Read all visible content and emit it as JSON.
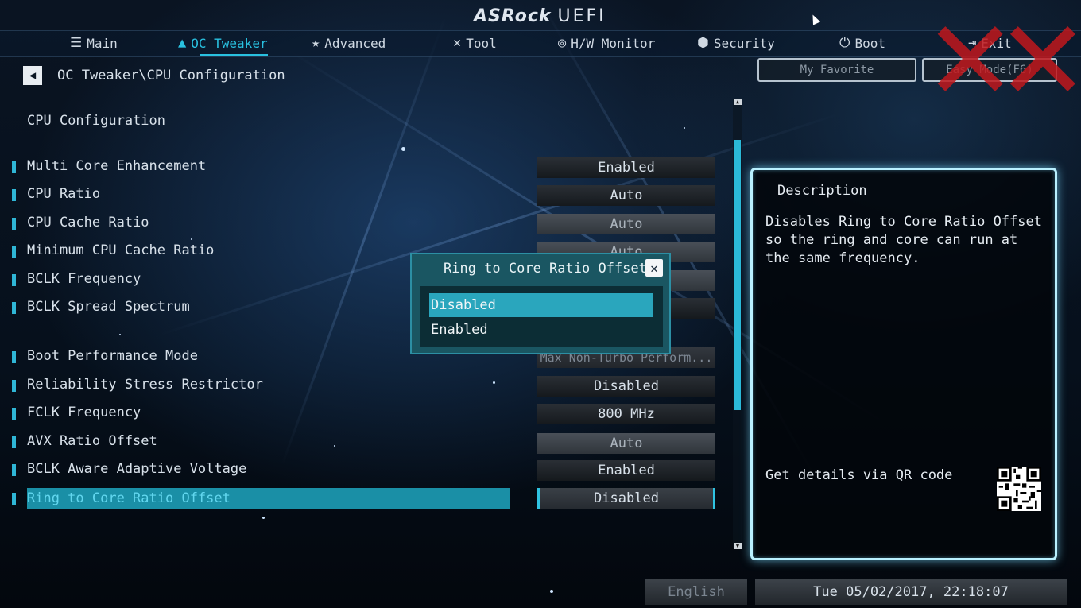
{
  "header": {
    "brand": "ASRock",
    "product": "UEFI",
    "watermark": "XX"
  },
  "tabs": [
    {
      "label": "Main",
      "icon": "list-icon"
    },
    {
      "label": "OC Tweaker",
      "icon": "flame-icon",
      "active": true
    },
    {
      "label": "Advanced",
      "icon": "star-icon"
    },
    {
      "label": "Tool",
      "icon": "tools-icon"
    },
    {
      "label": "H/W Monitor",
      "icon": "monitor-icon"
    },
    {
      "label": "Security",
      "icon": "shield-icon"
    },
    {
      "label": "Boot",
      "icon": "power-icon"
    },
    {
      "label": "Exit",
      "icon": "exit-icon"
    }
  ],
  "breadcrumb": "OC Tweaker\\CPU Configuration",
  "buttons": {
    "favorite": "My Favorite",
    "easy_mode": "Easy Mode(F6)"
  },
  "section_title": "CPU Configuration",
  "settings": [
    {
      "label": "Multi Core Enhancement",
      "value": "Enabled"
    },
    {
      "label": "CPU Ratio",
      "value": "Auto"
    },
    {
      "label": "CPU Cache Ratio",
      "value": "Auto"
    },
    {
      "label": "Minimum CPU Cache Ratio",
      "value": "Auto"
    },
    {
      "label": "BCLK Frequency",
      "value": "Auto"
    },
    {
      "label": "BCLK Spread Spectrum",
      "value": ""
    },
    {
      "label": "Boot Performance Mode",
      "value": "Max Non-Turbo Perform..."
    },
    {
      "label": "Reliability Stress Restrictor",
      "value": "Disabled"
    },
    {
      "label": "FCLK Frequency",
      "value": "800 MHz"
    },
    {
      "label": "AVX Ratio Offset",
      "value": "Auto"
    },
    {
      "label": "BCLK Aware Adaptive Voltage",
      "value": "Enabled"
    },
    {
      "label": "Ring to Core Ratio Offset",
      "value": "Disabled",
      "selected": true
    }
  ],
  "popup": {
    "title": "Ring to Core Ratio Offset",
    "close": "✕",
    "options": [
      "Disabled",
      "Enabled"
    ],
    "selected": "Disabled"
  },
  "description": {
    "title": "Description",
    "text": "Disables Ring to Core Ratio Offset so the ring and core can run at the same frequency.",
    "qr_label": "Get details via QR code"
  },
  "footer": {
    "language": "English",
    "datetime": "Tue 05/02/2017, 22:18:07"
  },
  "colors": {
    "accent": "#29c1e0",
    "selection": "#1a8fa6",
    "popup_bg": "#1a5662",
    "watermark": "#c0181d"
  }
}
